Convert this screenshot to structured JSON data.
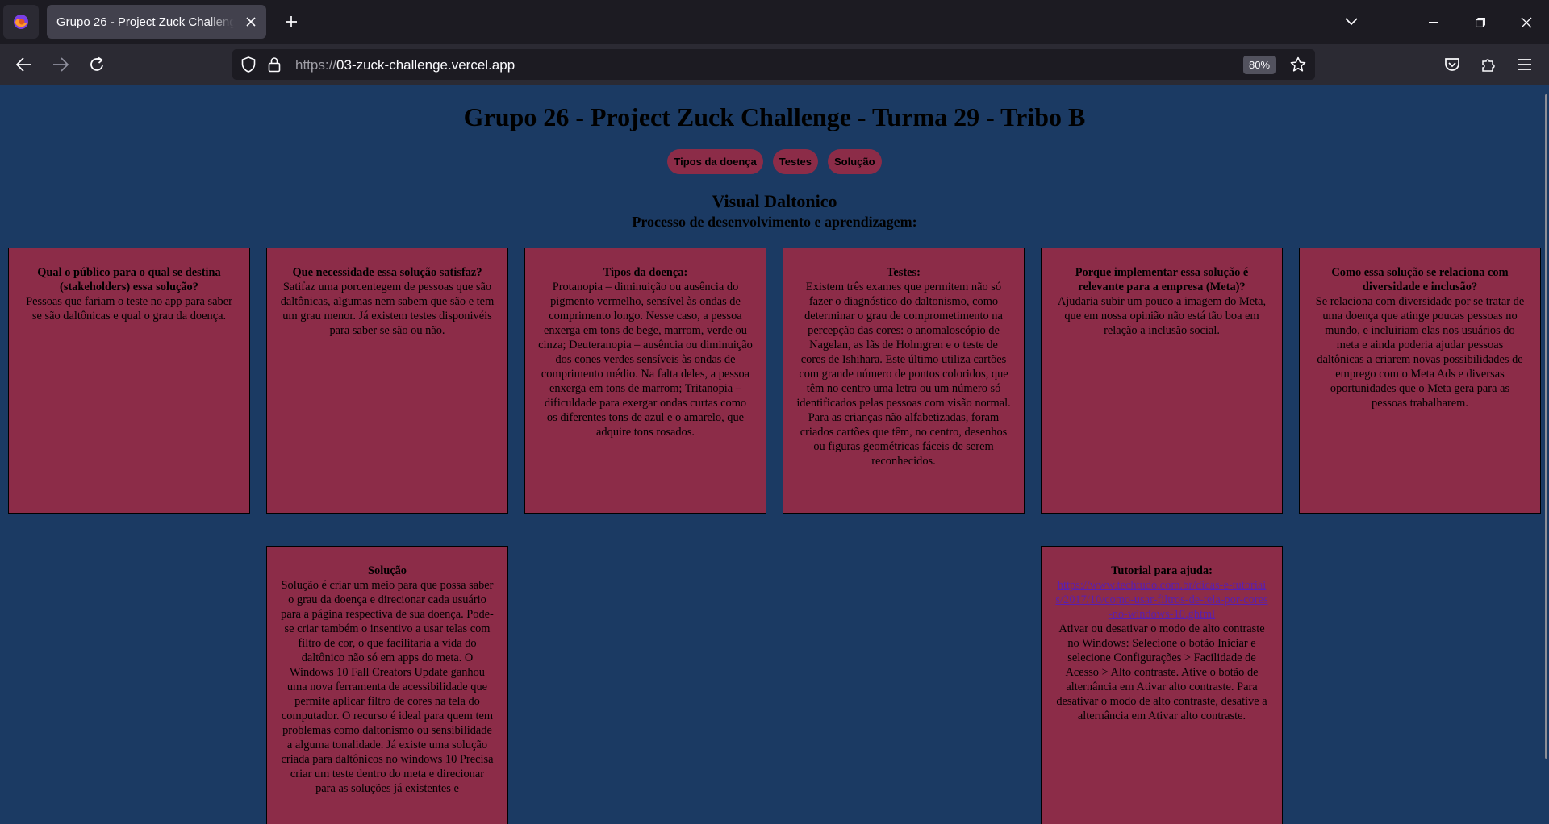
{
  "browser": {
    "tab_title": "Grupo 26 - Project Zuck Challenge - Turma 29 - Tribo B",
    "url_scheme": "https://",
    "url_host": "03-zuck-challenge.vercel.app",
    "zoom": "80%"
  },
  "page": {
    "title": "Grupo 26 - Project Zuck Challenge - Turma 29 - Tribo B",
    "nav": [
      "Tipos da doença",
      "Testes",
      "Solução"
    ],
    "subtitle": "Visual Daltonico",
    "subtitle2": "Processo de desenvolvimento e aprendizagem:"
  },
  "cards": [
    {
      "heading": "Qual o público para o qual se destina (stakeholders) essa solução?",
      "body": "Pessoas que fariam o teste no app para saber se são daltônicas e qual o grau da doença."
    },
    {
      "heading": "Que necessidade essa solução satisfaz?",
      "body": "Satifaz uma porcentegem de pessoas que são daltônicas, algumas nem sabem que são e tem um grau menor. Já existem testes disponivéis para saber se são ou não."
    },
    {
      "heading": "Tipos da doença:",
      "body": "Protanopia – diminuição ou ausência do pigmento vermelho, sensível às ondas de comprimento longo. Nesse caso, a pessoa enxerga em tons de bege, marrom, verde ou cinza; Deuteranopia – ausência ou diminuição dos cones verdes sensíveis às ondas de comprimento médio. Na falta deles, a pessoa enxerga em tons de marrom; Tritanopia – dificuldade para exergar ondas curtas como os diferentes tons de azul e o amarelo, que adquire tons rosados."
    },
    {
      "heading": "Testes:",
      "body": "Existem três exames que permitem não só fazer o diagnóstico do daltonismo, como determinar o grau de comprometimento na percepção das cores: o anomaloscópio de Nagelan, as lãs de Holmgren e o teste de cores de Ishihara. Este último utiliza cartões com grande número de pontos coloridos, que têm no centro uma letra ou um número só identificados pelas pessoas com visão normal. Para as crianças não alfabetizadas, foram criados cartões que têm, no centro, desenhos ou figuras geométricas fáceis de serem reconhecidos."
    },
    {
      "heading": "Porque implementar essa solução é relevante para a empresa (Meta)?",
      "body": "Ajudaria subir um pouco a imagem do Meta, que em nossa opinião não está tão boa em relação a inclusão social."
    },
    {
      "heading": "Como essa solução se relaciona com diversidade e inclusão?",
      "body": "Se relaciona com diversidade por se tratar de uma doença que atinge poucas pessoas no mundo, e incluiriam elas nos usuários do meta e ainda poderia ajudar pessoas daltônicas a criarem novas possibilidades de emprego com o Meta Ads e diversas oportunidades que o Meta gera para as pessoas trabalharem."
    },
    {
      "heading": "Solução",
      "body": "Solução é criar um meio para que possa saber o grau da doença e direcionar cada usuário para a página respectiva de sua doença. Pode-se criar também o insentivo a usar telas com filtro de cor, o que facilitaria a vida do daltônico não só em apps do meta. O Windows 10 Fall Creators Update ganhou uma nova ferramenta de acessibilidade que permite aplicar filtro de cores na tela do computador. O recurso é ideal para quem tem problemas como daltonismo ou sensibilidade a alguma tonalidade. Já existe uma solução criada para daltônicos no windows 10 Precisa criar um teste dentro do meta e direcionar para as soluções já existentes e"
    },
    {
      "heading": "Tutorial para ajuda:",
      "link": "https://www.techtudo.com.br/dicas-e-tutoriais/2017/10/como-usar-filtros-de-tela-por-cores-no-windows-10.ghtml",
      "body": "Ativar ou desativar o modo de alto contraste no Windows: Selecione o botão Iniciar e selecione Configurações > Facilidade de Acesso > Alto contraste. Ative o botão de alternância em Ativar alto contraste. Para desativar o modo de alto contraste, desative a alternância em Ativar alto contraste."
    }
  ]
}
